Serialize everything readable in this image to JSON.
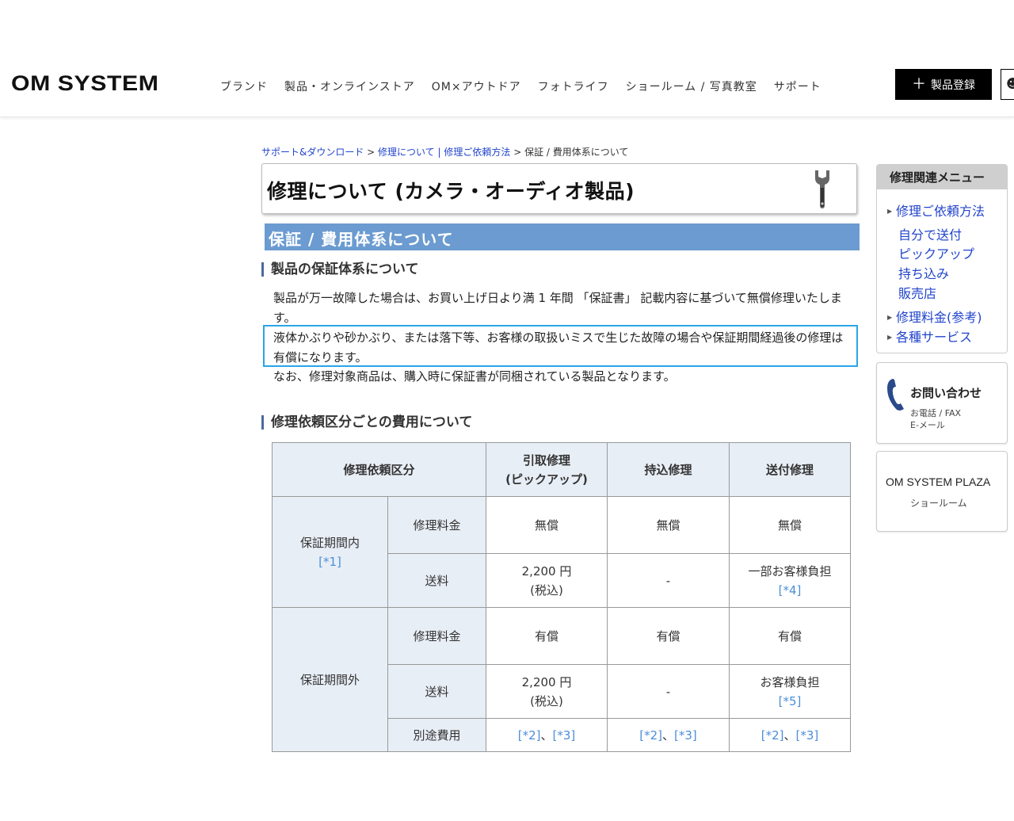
{
  "header": {
    "logo": "OM SYSTEM",
    "nav": [
      "ブランド",
      "製品・オンラインストア",
      "OM×アウトドア",
      "フォトライフ",
      "ショールーム / 写真教室",
      "サポート"
    ],
    "register_label": "製品登録"
  },
  "breadcrumb": {
    "item1": "サポート&ダウンロード",
    "sep1": " > ",
    "item2": "修理について | 修理ご依頼方法",
    "sep2": " > ",
    "current": "保証 / 費用体系について"
  },
  "main": {
    "title": "修理について (カメラ・オーディオ製品)",
    "section_title": "保証 / 費用体系について",
    "h_warranty": "製品の保証体系について",
    "para1": "製品が万一故障した場合は、お買い上げ日より満 1 年間 「保証書」 記載内容に基づいて無償修理いたします。",
    "para2": "液体かぶりや砂かぶり、または落下等、お客様の取扱いミスで生じた故障の場合や保証期間経過後の修理は有償になります。",
    "para3": "なお、修理対象商品は、購入時に保証書が同梱されている製品となります。",
    "h_fees": "修理依頼区分ごとの費用について"
  },
  "table": {
    "col_category": "修理依頼区分",
    "col_pickup_1": "引取修理",
    "col_pickup_2": "(ピックアップ)",
    "col_carryin": "持込修理",
    "col_send": "送付修理",
    "in_warranty": "保証期間内",
    "in_warranty_note": "[*1]",
    "out_warranty": "保証期間外",
    "repair_fee": "修理料金",
    "shipping": "送料",
    "extra": "別途費用",
    "free": "無償",
    "paid": "有償",
    "pickup_ship_1": "2,200 円",
    "pickup_ship_2": "(税込)",
    "dash": "-",
    "send_in_ship": "一部お客様負担",
    "send_in_note": "[*4]",
    "send_out_ship": "お客様負担",
    "send_out_note": "[*5]",
    "note2": "[*2]",
    "note_sep": "、",
    "note3": "[*3]"
  },
  "sidebar": {
    "menu_title": "修理関連メニュー",
    "items": [
      "修理ご依頼方法",
      "自分で送付",
      "ピックアップ",
      "持ち込み",
      "販売店",
      "修理料金(参考)",
      "各種サービス"
    ],
    "contact_title": "お問い合わせ",
    "contact_sub1": "お電話 / FAX",
    "contact_sub2": "E-メール",
    "plaza_title": "OM SYSTEM PLAZA",
    "plaza_sub": "ショールーム"
  },
  "colors": {
    "section_bar": "#6b9bd0",
    "link": "#2244cc",
    "note": "#4c8ed8",
    "highlight_border": "#2aa5e8",
    "table_header_bg": "#e8eef6"
  }
}
